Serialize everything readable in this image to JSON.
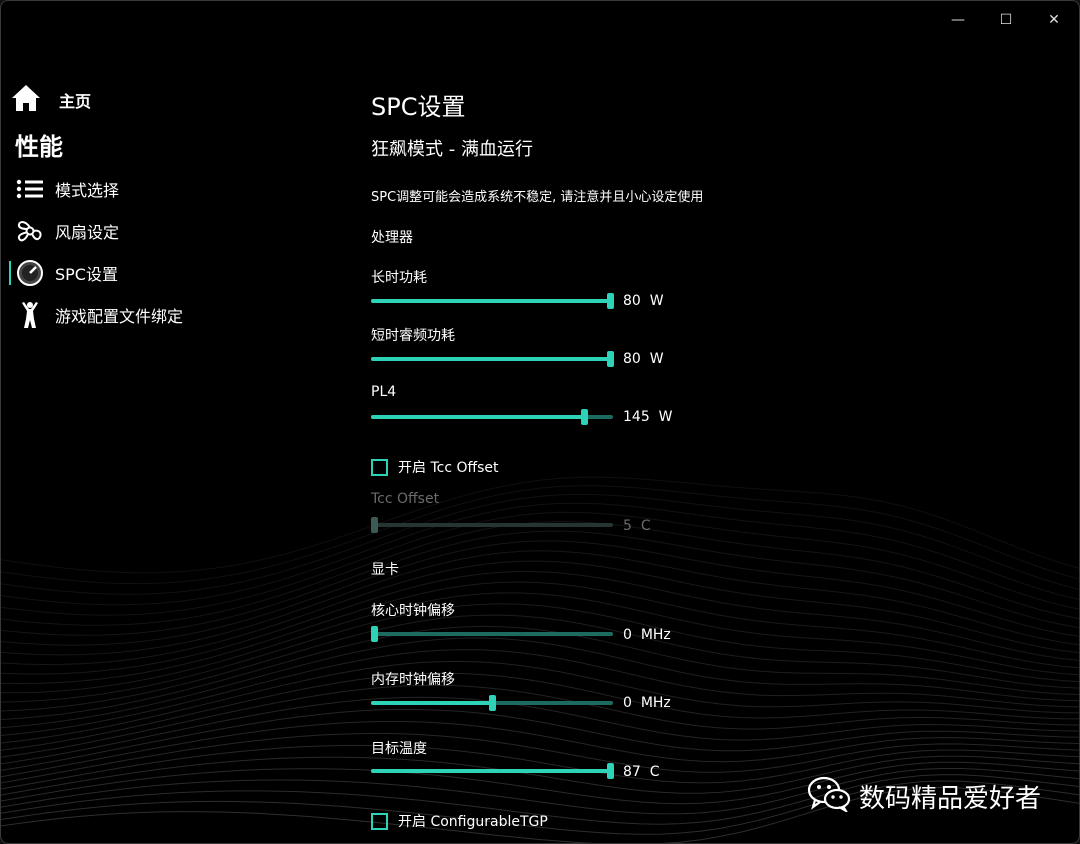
{
  "window": {
    "minimize_glyph": "—",
    "maximize_glyph": "☐",
    "close_glyph": "✕"
  },
  "sidebar": {
    "home": {
      "label": "主页",
      "icon": "home-icon"
    },
    "section_title": "性能",
    "items": [
      {
        "label": "模式选择",
        "icon": "list-icon",
        "active": false
      },
      {
        "label": "风扇设定",
        "icon": "fan-icon",
        "active": false
      },
      {
        "label": "SPC设置",
        "icon": "gauge-icon",
        "active": true
      },
      {
        "label": "游戏配置文件绑定",
        "icon": "figure-icon",
        "active": false
      }
    ]
  },
  "main": {
    "title": "SPC设置",
    "mode_title": "狂飙模式 - 满血运行",
    "warning": "SPC调整可能会造成系统不稳定, 请注意并且小心设定使用",
    "cpu_group": "处理器",
    "cpu_sliders": [
      {
        "label": "长时功耗",
        "value": "80",
        "unit": "W",
        "fraction": 1.0
      },
      {
        "label": "短时睿频功耗",
        "value": "80",
        "unit": "W",
        "fraction": 1.0
      },
      {
        "label": "PL4",
        "value": "145",
        "unit": "W",
        "fraction": 0.88
      }
    ],
    "tcc_checkbox": {
      "label": "开启 Tcc Offset",
      "checked": false
    },
    "tcc_slider": {
      "label": "Tcc Offset",
      "value": "5",
      "unit": "C",
      "fraction": 0.0,
      "enabled": false
    },
    "gpu_group": "显卡",
    "gpu_sliders": [
      {
        "label": "核心时钟偏移",
        "value": "0",
        "unit": "MHz",
        "fraction": 0.0
      },
      {
        "label": "内存时钟偏移",
        "value": "0",
        "unit": "MHz",
        "fraction": 0.5
      },
      {
        "label": "目标温度",
        "value": "87",
        "unit": "C",
        "fraction": 1.0
      }
    ],
    "tgp_checkbox": {
      "label": "开启 ConfigurableTGP",
      "checked": false
    }
  },
  "watermark": {
    "text": "数码精品爱好者",
    "icon": "wechat-icon"
  },
  "colors": {
    "accent": "#2ed3b7",
    "track": "#1d6a60",
    "background": "#000000"
  }
}
